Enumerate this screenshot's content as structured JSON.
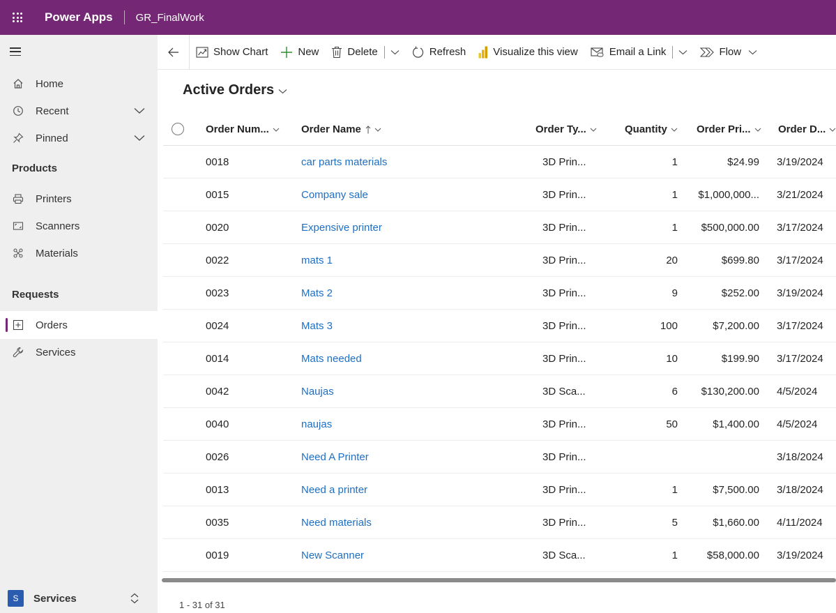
{
  "topbar": {
    "app_name": "Power Apps",
    "environment": "GR_FinalWork"
  },
  "sidebar": {
    "top_items": [
      {
        "label": "Home",
        "icon": "home-icon"
      },
      {
        "label": "Recent",
        "icon": "clock-icon"
      },
      {
        "label": "Pinned",
        "icon": "pin-icon"
      }
    ],
    "groups": [
      {
        "title": "Products",
        "items": [
          {
            "label": "Printers",
            "icon": "printer-icon"
          },
          {
            "label": "Scanners",
            "icon": "scanner-icon"
          },
          {
            "label": "Materials",
            "icon": "materials-icon"
          }
        ]
      },
      {
        "title": "Requests",
        "items": [
          {
            "label": "Orders",
            "icon": "orders-icon",
            "selected": true
          },
          {
            "label": "Services",
            "icon": "wrench-icon"
          }
        ]
      }
    ],
    "area": {
      "badge": "S",
      "label": "Services"
    }
  },
  "commandbar": {
    "show_chart": "Show Chart",
    "new": "New",
    "delete": "Delete",
    "refresh": "Refresh",
    "visualize": "Visualize this view",
    "email_link": "Email a Link",
    "flow": "Flow"
  },
  "view": {
    "title": "Active Orders"
  },
  "grid": {
    "columns": {
      "order_number": "Order Num...",
      "order_name": "Order Name",
      "order_type": "Order Ty...",
      "quantity": "Quantity",
      "order_price": "Order Pri...",
      "order_date": "Order D..."
    },
    "rows": [
      {
        "number": "0018",
        "name": "car parts materials",
        "type": "3D Prin...",
        "quantity": "1",
        "price": "$24.99",
        "date": "3/19/2024"
      },
      {
        "number": "0015",
        "name": "Company sale",
        "type": "3D Prin...",
        "quantity": "1",
        "price": "$1,000,000...",
        "date": "3/21/2024"
      },
      {
        "number": "0020",
        "name": "Expensive printer",
        "type": "3D Prin...",
        "quantity": "1",
        "price": "$500,000.00",
        "date": "3/17/2024"
      },
      {
        "number": "0022",
        "name": "mats 1",
        "type": "3D Prin...",
        "quantity": "20",
        "price": "$699.80",
        "date": "3/17/2024"
      },
      {
        "number": "0023",
        "name": "Mats 2",
        "type": "3D Prin...",
        "quantity": "9",
        "price": "$252.00",
        "date": "3/19/2024"
      },
      {
        "number": "0024",
        "name": "Mats 3",
        "type": "3D Prin...",
        "quantity": "100",
        "price": "$7,200.00",
        "date": "3/17/2024"
      },
      {
        "number": "0014",
        "name": "Mats needed",
        "type": "3D Prin...",
        "quantity": "10",
        "price": "$199.90",
        "date": "3/17/2024"
      },
      {
        "number": "0042",
        "name": "Naujas",
        "type": "3D Sca...",
        "quantity": "6",
        "price": "$130,200.00",
        "date": "4/5/2024"
      },
      {
        "number": "0040",
        "name": "naujas",
        "type": "3D Prin...",
        "quantity": "50",
        "price": "$1,400.00",
        "date": "4/5/2024"
      },
      {
        "number": "0026",
        "name": "Need A Printer",
        "type": "3D Prin...",
        "quantity": "",
        "price": "",
        "date": "3/18/2024"
      },
      {
        "number": "0013",
        "name": "Need a printer",
        "type": "3D Prin...",
        "quantity": "1",
        "price": "$7,500.00",
        "date": "3/18/2024"
      },
      {
        "number": "0035",
        "name": "Need materials",
        "type": "3D Prin...",
        "quantity": "5",
        "price": "$1,660.00",
        "date": "4/11/2024"
      },
      {
        "number": "0019",
        "name": "New Scanner",
        "type": "3D Sca...",
        "quantity": "1",
        "price": "$58,000.00",
        "date": "3/19/2024"
      }
    ]
  },
  "paging": {
    "text": "1 - 31 of 31"
  },
  "colors": {
    "brand": "#742774",
    "link": "#1e6fc4",
    "sidebar_bg": "#efefef"
  }
}
